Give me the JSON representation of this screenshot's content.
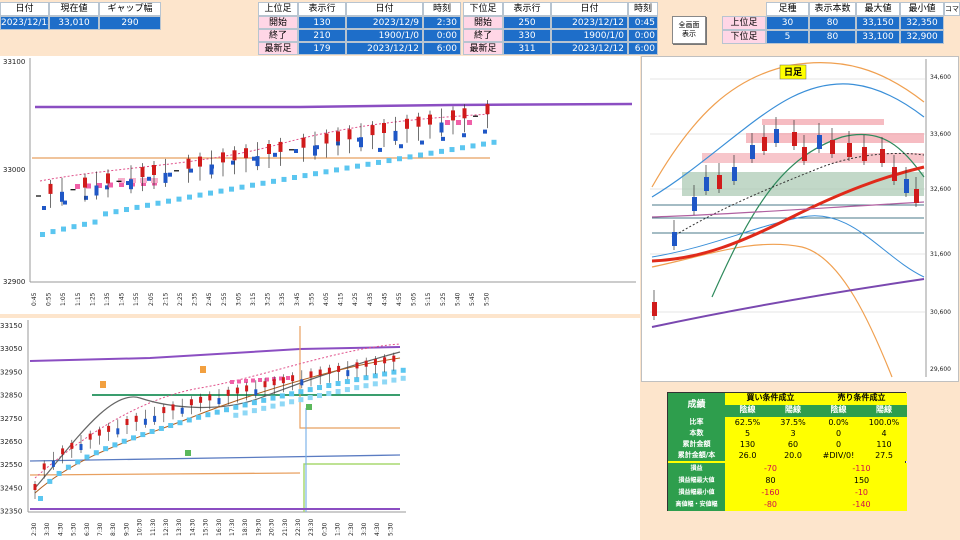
{
  "colors": {
    "up": "#d01b1b",
    "down": "#1f57c6",
    "accent": "#1e6ec9",
    "teal": "#2e9e4d"
  },
  "topbar": {
    "h_date": "日付",
    "h_price": "現在値",
    "h_gap": "ギャップ幅",
    "date": "2023/12/12",
    "price": "33,010",
    "gap": "290"
  },
  "upper_tbl": {
    "headers": [
      "上位足",
      "表示行",
      "日付",
      "時刻"
    ],
    "rows": [
      [
        "開始",
        "130",
        "2023/12/9",
        "2:30"
      ],
      [
        "終了",
        "210",
        "1900/1/0",
        "0:00"
      ],
      [
        "最新足",
        "179",
        "2023/12/12",
        "6:00"
      ]
    ]
  },
  "lower_tbl": {
    "headers": [
      "下位足",
      "表示行",
      "日付",
      "時刻"
    ],
    "rows": [
      [
        "開始",
        "250",
        "2023/12/12",
        "0:45"
      ],
      [
        "終了",
        "330",
        "1900/1/0",
        "0:00"
      ],
      [
        "最新足",
        "311",
        "2023/12/12",
        "6:00"
      ]
    ]
  },
  "fullscreen_button": {
    "line1": "全画面",
    "line2": "表示"
  },
  "right_tbl": {
    "headers": [
      "足種",
      "表示本数",
      "最大値",
      "最小値",
      "コマ"
    ],
    "rows": [
      [
        "上位足",
        "30",
        "80",
        "33,150",
        "32,350"
      ],
      [
        "下位足",
        "5",
        "80",
        "33,100",
        "32,900"
      ]
    ]
  },
  "chart_top": {
    "y_ticks": [
      "33100",
      "33000",
      "32900"
    ],
    "x_ticks": [
      "0:45",
      "1:05",
      "1:25",
      "1:45",
      "2:05",
      "2:25",
      "2:45",
      "3:05",
      "3:25",
      "3:45",
      "4:05",
      "4:25",
      "4:45",
      "5:05",
      "5:25",
      "5:45"
    ],
    "x_ticks2": [
      "0:55",
      "1:15",
      "1:35",
      "1:55",
      "2:15",
      "2:35",
      "2:55",
      "3:15",
      "3:35",
      "3:55",
      "4:15",
      "4:35",
      "4:55",
      "5:15",
      "5:40",
      "5:50"
    ]
  },
  "chart_bottom": {
    "y_ticks": [
      "33150",
      "33050",
      "32950",
      "32850",
      "32750",
      "32650",
      "32550",
      "32450",
      "32350"
    ],
    "x_ticks": [
      "2:30",
      "4:30",
      "6:30",
      "8:30",
      "10:30",
      "12:30",
      "14:30",
      "16:30",
      "18:30",
      "20:30",
      "22:30",
      "0:30",
      "2:30",
      "4:30"
    ],
    "x_ticks2": [
      "3:30",
      "5:30",
      "7:30",
      "9:30",
      "11:30",
      "13:30",
      "15:30",
      "17:30",
      "19:30",
      "21:30",
      "23:30",
      "1:30",
      "3:30",
      "5:30"
    ]
  },
  "chart_daily": {
    "label": "日足",
    "y_ticks": [
      "34,600",
      "33,600",
      "32,600",
      "31,600",
      "30,600",
      "29,600"
    ]
  },
  "stats": {
    "title": "成績",
    "buy_header": "買い条件成立",
    "sell_header": "売り条件成立",
    "sub": [
      "陰線",
      "陽線",
      "陰線",
      "陽線"
    ],
    "rows": [
      {
        "label": "比率",
        "v": [
          "62.5%",
          "37.5%",
          "0.0%",
          "100.0%"
        ]
      },
      {
        "label": "本数",
        "v": [
          "5",
          "3",
          "0",
          "4"
        ]
      },
      {
        "label": "累計金額",
        "v": [
          "130",
          "60",
          "0",
          "110"
        ]
      },
      {
        "label": "累計金額/本",
        "v": [
          "26.0",
          "20.0",
          "#DIV/0!",
          "27.5"
        ]
      }
    ],
    "rows2": [
      {
        "label": "損益",
        "buy": "-70",
        "sell": "-110"
      },
      {
        "label": "損益幅最大値",
        "buy": "80",
        "sell": "150"
      },
      {
        "label": "損益幅最小値",
        "buy": "-160",
        "sell": "-10"
      },
      {
        "label": "高値幅・安値幅",
        "buy": "-80",
        "sell": "-140"
      }
    ]
  }
}
